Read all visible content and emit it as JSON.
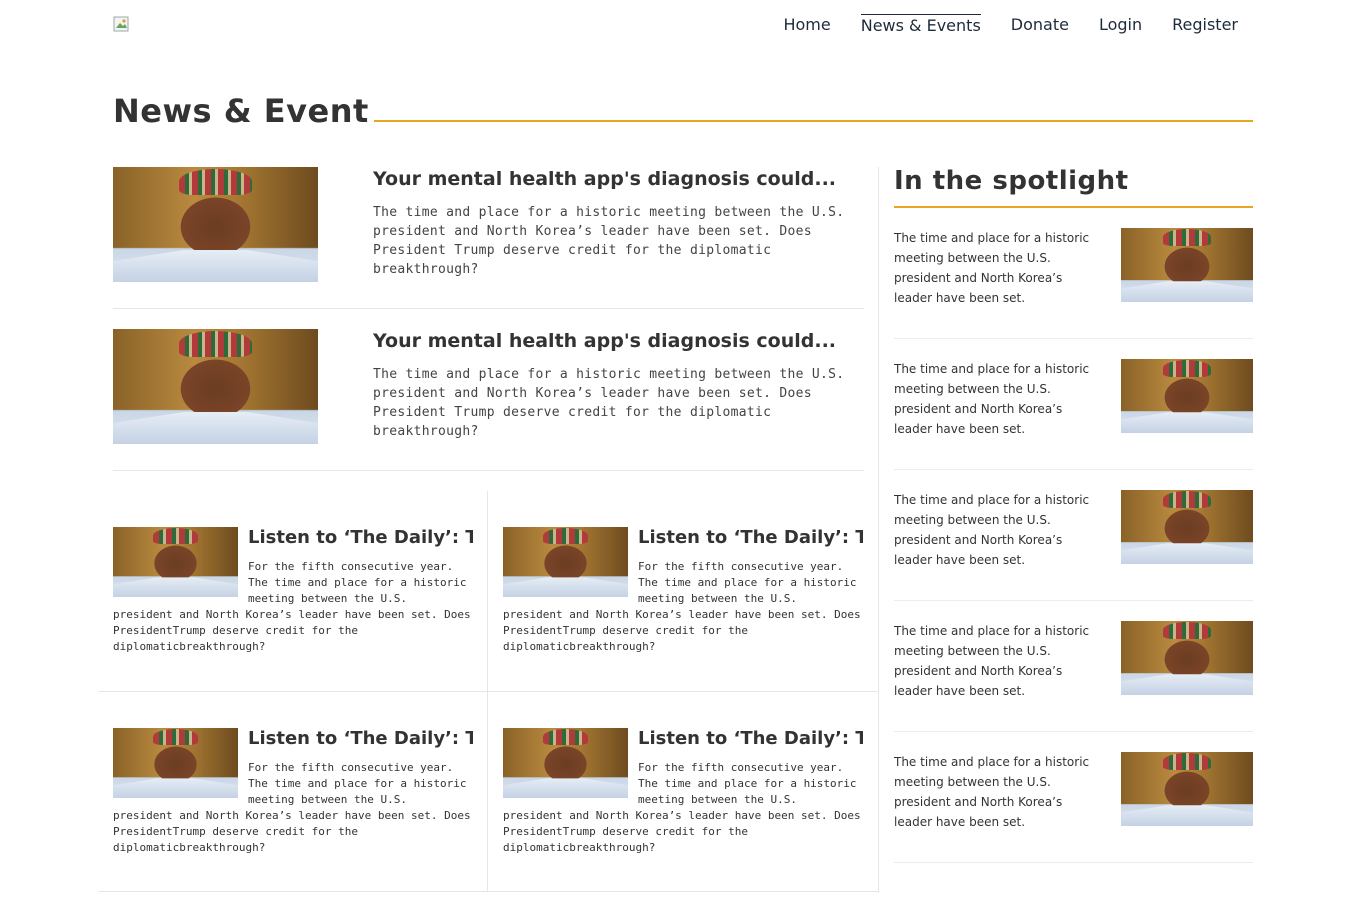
{
  "header": {
    "logo_alt": "",
    "nav": [
      {
        "label": "Home",
        "active": false
      },
      {
        "label": "News & Events",
        "active": true
      },
      {
        "label": "Donate",
        "active": false
      },
      {
        "label": "Login",
        "active": false
      },
      {
        "label": "Register",
        "active": false
      }
    ]
  },
  "page": {
    "title": "News & Event",
    "accent_color": "#e8a524"
  },
  "featured": [
    {
      "title": "Your mental health app's diagnosis could...",
      "body": "The time and place for a historic meeting between the U.S. president and North Korea’s leader have been set. Does President Trump deserve credit for the diplomatic breakthrough?"
    },
    {
      "title": "Your mental health app's diagnosis could...",
      "body": "The time and place for a historic meeting between the U.S. president and North Korea’s leader have been set. Does President Trump deserve credit for the diplomatic breakthrough?"
    }
  ],
  "cards": [
    {
      "title": "Listen to ‘The Daily’: The",
      "body": "For the fifth consecutive year. The time and place for a historic meeting between the U.S. president and North Korea’s leader have been set. Does PresidentTrump deserve credit for the diplomaticbreakthrough?"
    },
    {
      "title": "Listen to ‘The Daily’: The",
      "body": "For the fifth consecutive year. The time and place for a historic meeting between the U.S. president and North Korea’s leader have been set. Does PresidentTrump deserve credit for the diplomaticbreakthrough?"
    },
    {
      "title": "Listen to ‘The Daily’: The",
      "body": "For the fifth consecutive year. The time and place for a historic meeting between the U.S. president and North Korea’s leader have been set. Does PresidentTrump deserve credit for the diplomaticbreakthrough?"
    },
    {
      "title": "Listen to ‘The Daily’: The",
      "body": "For the fifth consecutive year. The time and place for a historic meeting between the U.S. president and North Korea’s leader have been set. Does PresidentTrump deserve credit for the diplomaticbreakthrough?"
    }
  ],
  "spotlight": {
    "title": "In the spotlight",
    "items": [
      {
        "text": "The time and place for a historic meeting between the U.S. president and North Korea’s leader have been set."
      },
      {
        "text": "The time and place for a historic meeting between the U.S. president and North Korea’s leader have been set."
      },
      {
        "text": "The time and place for a historic meeting between the U.S. president and North Korea’s leader have been set."
      },
      {
        "text": "The time and place for a historic meeting between the U.S. president and North Korea’s leader have been set."
      },
      {
        "text": "The time and place for a historic meeting between the U.S. president and North Korea’s leader have been set."
      }
    ]
  }
}
